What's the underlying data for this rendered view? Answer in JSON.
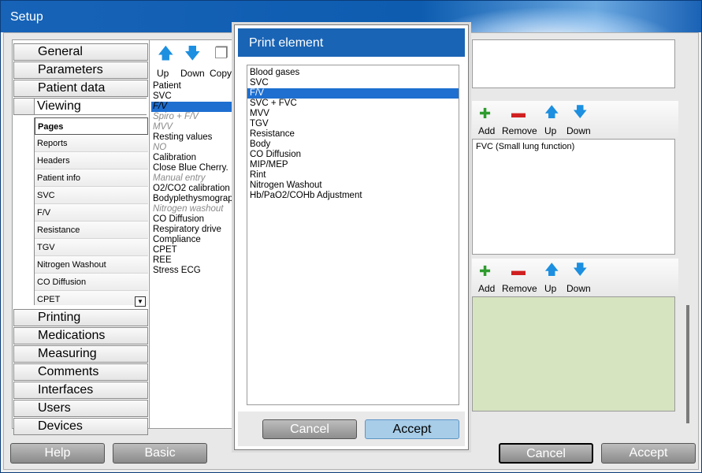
{
  "window": {
    "title": "Setup"
  },
  "categories_top": [
    "General",
    "Parameters",
    "Patient data",
    "Viewing"
  ],
  "viewing_subitems": [
    "Pages",
    "Reports",
    "Headers",
    "Patient info",
    "SVC",
    "F/V",
    "Resistance",
    "TGV",
    "Nitrogen Washout",
    "CO Diffusion",
    "CPET"
  ],
  "categories_bottom": [
    "Printing",
    "Medications",
    "Measuring",
    "Comments",
    "Interfaces",
    "Users",
    "Devices"
  ],
  "mid_toolbar": {
    "up": "Up",
    "down": "Down",
    "copy": "Copy"
  },
  "mid_list": [
    {
      "label": "Patient",
      "style": "normal"
    },
    {
      "label": "SVC",
      "style": "normal"
    },
    {
      "label": "F/V",
      "style": "selected"
    },
    {
      "label": "Spiro + F/V",
      "style": "italic"
    },
    {
      "label": "MVV",
      "style": "italic"
    },
    {
      "label": "Resting values",
      "style": "normal"
    },
    {
      "label": "NO",
      "style": "italic"
    },
    {
      "label": "Calibration",
      "style": "normal"
    },
    {
      "label": "Close Blue Cherry.",
      "style": "normal"
    },
    {
      "label": "Manual entry",
      "style": "italic"
    },
    {
      "label": "O2/CO2 calibration",
      "style": "normal"
    },
    {
      "label": "Bodyplethysmograph",
      "style": "normal"
    },
    {
      "label": "Nitrogen washout",
      "style": "italic"
    },
    {
      "label": "CO Diffusion",
      "style": "normal"
    },
    {
      "label": "Respiratory drive",
      "style": "normal"
    },
    {
      "label": "Compliance",
      "style": "normal"
    },
    {
      "label": "CPET",
      "style": "normal"
    },
    {
      "label": "REE",
      "style": "normal"
    },
    {
      "label": "Stress ECG",
      "style": "normal"
    }
  ],
  "right_toolbar": {
    "add": "Add",
    "remove": "Remove",
    "up": "Up",
    "down": "Down"
  },
  "right_list_item": "FVC (Small lung function)",
  "dialog": {
    "title": "Print element",
    "items": [
      "Blood gases",
      "SVC",
      "F/V",
      "SVC + FVC",
      "MVV",
      "TGV",
      "Resistance",
      "Body",
      "CO Diffusion",
      "MIP/MEP",
      "Rint",
      "Nitrogen Washout",
      "Hb/PaO2/COHb Adjustment"
    ],
    "selected_index": 2,
    "cancel": "Cancel",
    "accept": "Accept"
  },
  "bottom_buttons": {
    "help": "Help",
    "basic": "Basic",
    "cancel": "Cancel",
    "accept": "Accept"
  }
}
